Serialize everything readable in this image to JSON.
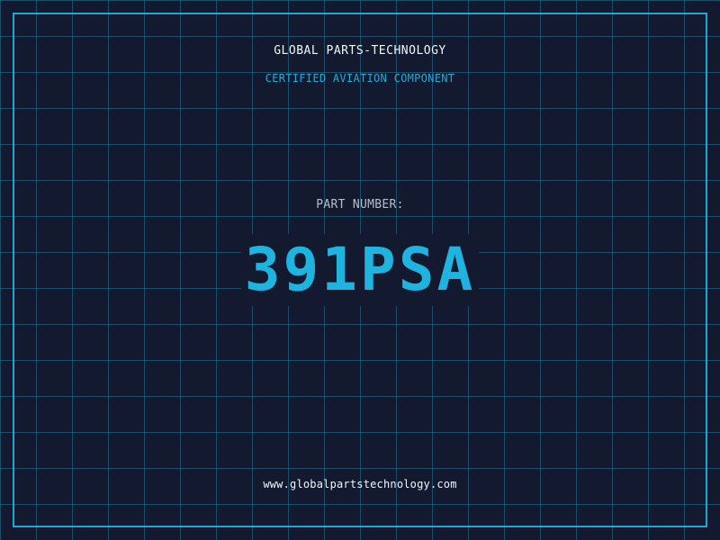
{
  "header": {
    "brand": "GLOBAL PARTS-TECHNOLOGY",
    "subtitle": "CERTIFIED AVIATION COMPONENT"
  },
  "part": {
    "label": "PART NUMBER:",
    "number": "391PSA"
  },
  "footer": {
    "url": "www.globalpartstechnology.com"
  },
  "colors": {
    "background": "#131a2f",
    "grid": "#268caa",
    "accent": "#1ea7d6",
    "text": "#f2f6fa",
    "muted": "#b4bfcc"
  }
}
